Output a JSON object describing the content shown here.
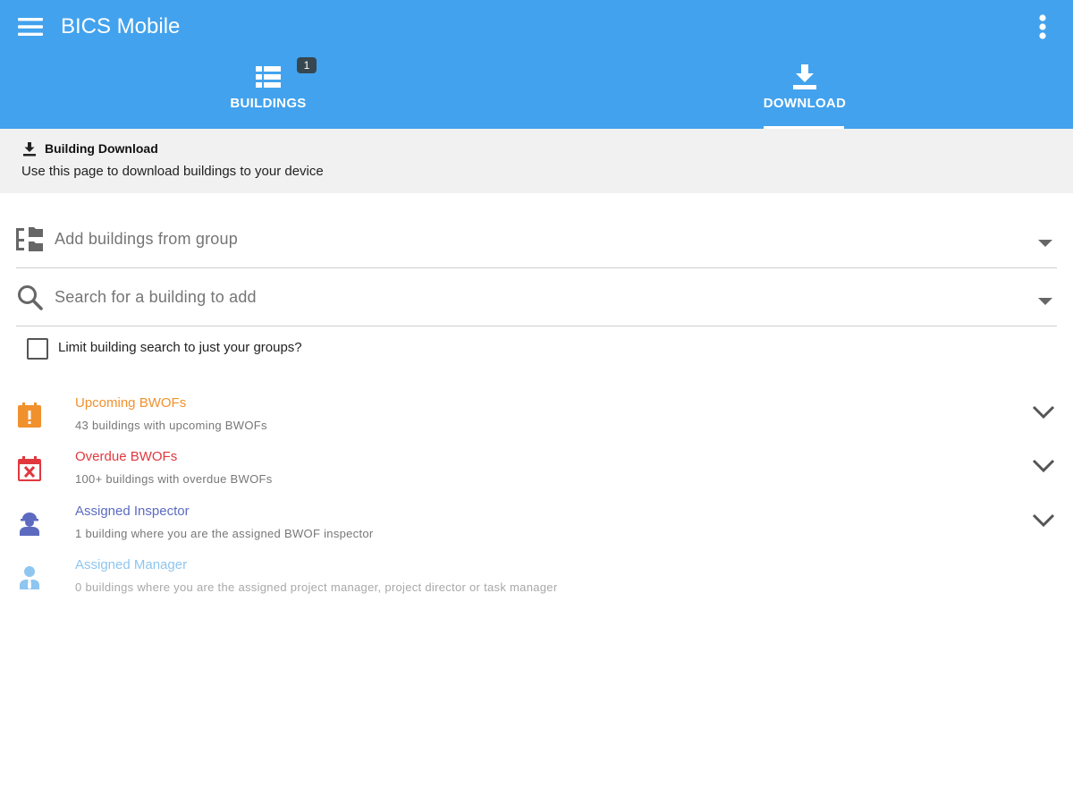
{
  "app": {
    "title": "BICS Mobile",
    "accent_color": "#42a2ed",
    "menu_icon": "hamburger-menu-icon",
    "overflow_icon": "more-vert-icon"
  },
  "tabs": [
    {
      "label": "BUILDINGS",
      "icon": "table-list-icon",
      "badge": "1",
      "selected": false
    },
    {
      "label": "DOWNLOAD",
      "icon": "download-icon",
      "selected": true
    }
  ],
  "info": {
    "icon": "download-icon",
    "title": "Building Download",
    "description": "Use this page to download buildings to your device"
  },
  "fields": {
    "group": {
      "placeholder": "Add buildings from group",
      "icon": "group-tree-icon"
    },
    "search": {
      "placeholder": "Search for a building to add",
      "icon": "search-icon"
    }
  },
  "limit_checkbox": {
    "label": "Limit building search to just your groups?",
    "checked": false
  },
  "categories": [
    {
      "title": "Upcoming BWOFs",
      "subtitle": "43 buildings with upcoming BWOFs",
      "color": "#f0912d",
      "icon": "calendar-alert-icon",
      "expandable": true
    },
    {
      "title": "Overdue BWOFs",
      "subtitle": "100+ buildings with overdue BWOFs",
      "color": "#e0383e",
      "icon": "calendar-remove-icon",
      "expandable": true
    },
    {
      "title": "Assigned Inspector",
      "subtitle": "1 building where you are the assigned BWOF inspector",
      "color": "#5c6bc0",
      "icon": "inspector-person-icon",
      "expandable": true
    },
    {
      "title": "Assigned Manager",
      "subtitle": "0 buildings where you are the assigned project manager, project director or task manager",
      "color": "#8ec6f0",
      "icon": "manager-person-icon",
      "expandable": false
    }
  ]
}
